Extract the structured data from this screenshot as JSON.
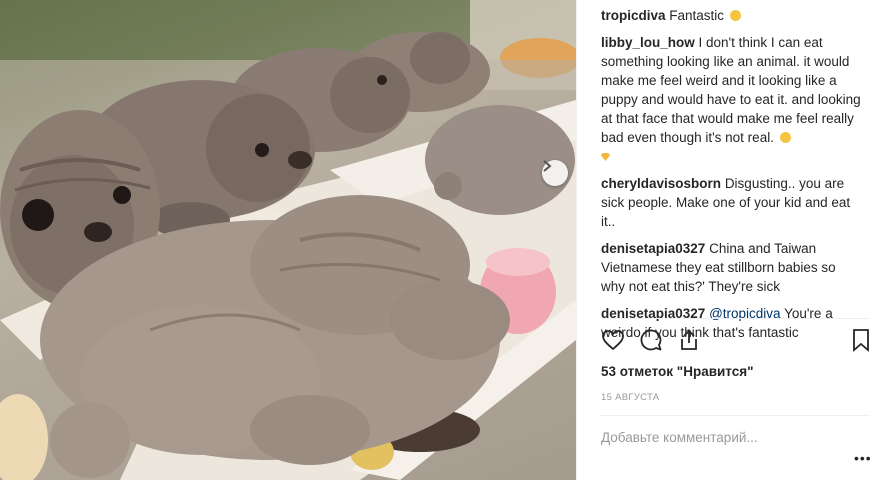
{
  "post": {
    "photo_alt": "photo",
    "comments": [
      {
        "user": "tropicdiva",
        "text": "Fantastic",
        "emoji": "grin-emoji"
      },
      {
        "user": "libby_lou_how",
        "text": "I don't think I can eat something looking like an animal. it would make me feel weird and it looking like a puppy and would have to eat it. and looking at that face that would make me feel really bad even though it's not real.",
        "emoji": "astonished-emoji",
        "emoji2": "gem-emoji"
      },
      {
        "user": "cheryldavisosborn",
        "text": "Disgusting.. you are sick people. Make one of your kid and eat it.."
      },
      {
        "user": "denisetapia0327",
        "text": "China and Taiwan Vietnamese they eat stillborn babies so why not eat this?' They're sick"
      },
      {
        "user": "denisetapia0327",
        "mention": "@tropicdiva",
        "text": "You're a weirdo if you think that's fantastic"
      }
    ],
    "likes_text": "53 отметок \"Нравится\"",
    "date_text": "15 АВГУСТА",
    "add_comment_placeholder": "Добавьте комментарий...",
    "more_label": "•••"
  },
  "icons": {
    "like": "heart-icon",
    "comment": "comment-bubble-icon",
    "share": "share-icon",
    "save": "bookmark-icon",
    "next": "chevron-right-icon"
  },
  "colors": {
    "link": "#003569",
    "muted": "#999999",
    "text": "#262626"
  }
}
